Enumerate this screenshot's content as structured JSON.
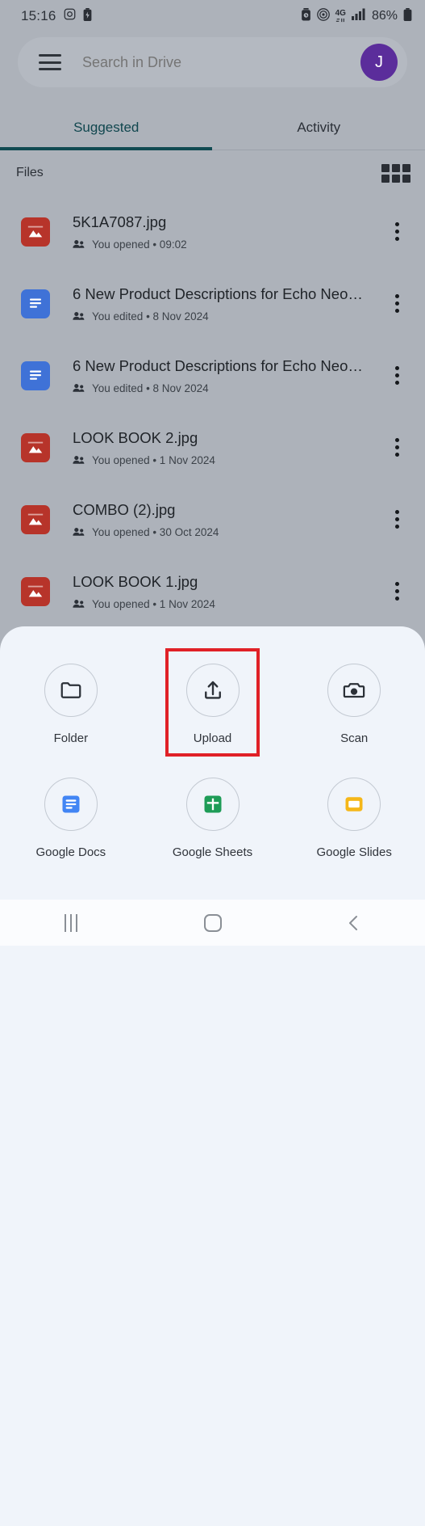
{
  "status_bar": {
    "clock": "15:16",
    "left_icons": [
      "camera-icon",
      "battery-saver-icon"
    ],
    "right_icons": [
      "alarm-icon",
      "hotspot-icon",
      "network-4g-icon",
      "signal-bars-icon"
    ],
    "network_label": "4G",
    "battery_percent": "86%"
  },
  "search": {
    "placeholder": "Search in Drive",
    "value": "",
    "menu_icon": "hamburger-menu-icon",
    "avatar_initial": "J",
    "avatar_color": "#5B2D9B"
  },
  "tabs": [
    {
      "label": "Suggested",
      "active": true
    },
    {
      "label": "Activity",
      "active": false
    }
  ],
  "files_section": {
    "label": "Files",
    "view_toggle_icon": "grid-view-icon"
  },
  "files": [
    {
      "name": "5K1A7087.jpg",
      "meta": "You opened • 09:02",
      "icon": "image-file-icon",
      "kind": "image"
    },
    {
      "name": "6 New Product Descriptions for Echo Neo…",
      "meta": "You edited • 8 Nov 2024",
      "icon": "google-docs-file-icon",
      "kind": "doc"
    },
    {
      "name": "6 New Product Descriptions for Echo Neo…",
      "meta": "You edited • 8 Nov 2024",
      "icon": "google-docs-file-icon",
      "kind": "doc"
    },
    {
      "name": "LOOK BOOK 2.jpg",
      "meta": "You opened • 1 Nov 2024",
      "icon": "image-file-icon",
      "kind": "image"
    },
    {
      "name": "COMBO (2).jpg",
      "meta": "You opened • 30 Oct 2024",
      "icon": "image-file-icon",
      "kind": "image"
    },
    {
      "name": "LOOK BOOK 1.jpg",
      "meta": "You opened • 1 Nov 2024",
      "icon": "image-file-icon",
      "kind": "image"
    }
  ],
  "create_sheet": {
    "items": [
      {
        "label": "Folder",
        "icon": "folder-icon"
      },
      {
        "label": "Upload",
        "icon": "upload-icon",
        "highlighted": true
      },
      {
        "label": "Scan",
        "icon": "camera-scan-icon"
      },
      {
        "label": "Google Docs",
        "icon": "google-docs-icon"
      },
      {
        "label": "Google Sheets",
        "icon": "google-sheets-icon"
      },
      {
        "label": "Google Slides",
        "icon": "google-slides-icon"
      }
    ],
    "highlight_color": "#E02127",
    "background": "#F0F4FA"
  },
  "nav_bar": {
    "recents_label": "Recents",
    "home_label": "Home",
    "back_label": "Back"
  }
}
